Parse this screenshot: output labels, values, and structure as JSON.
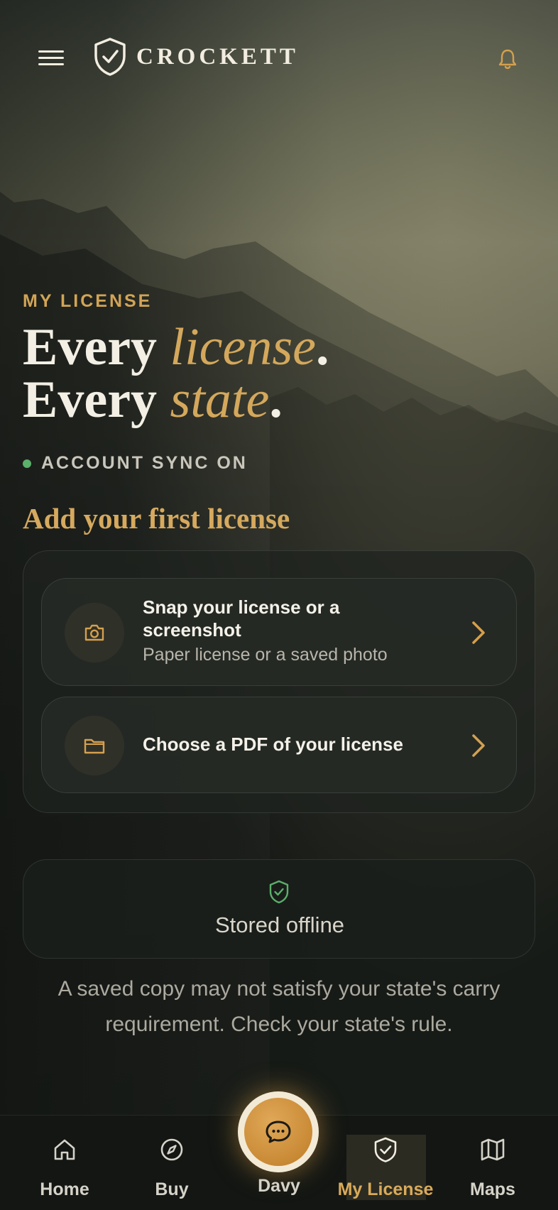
{
  "header": {
    "brand": "CROCKETT",
    "menu_icon": "hamburger-menu-icon",
    "logo_icon": "shield-check-icon",
    "bell_icon": "bell-icon"
  },
  "hero": {
    "eyebrow": "MY LICENSE",
    "line1_plain": "Every ",
    "line1_accent": "license",
    "line1_end": ".",
    "line2_plain": "Every ",
    "line2_accent": "state",
    "line2_end": ".",
    "sync_status": "ACCOUNT SYNC ON"
  },
  "add_section": {
    "title": "Add your first license",
    "options": [
      {
        "icon": "camera-icon",
        "title": "Snap your license or a screenshot",
        "subtitle": "Paper license or a saved photo"
      },
      {
        "icon": "folder-icon",
        "title": "Choose a PDF of your license"
      }
    ]
  },
  "offline": {
    "icon": "shield-check-icon",
    "label": "Stored offline",
    "note": "A saved copy may not satisfy your state's carry requirement. Check your state's rule."
  },
  "nav": {
    "items": [
      {
        "label": "Home",
        "icon": "home-icon"
      },
      {
        "label": "Buy",
        "icon": "compass-icon"
      },
      {
        "label": "Davy",
        "icon": "chat-bubble-icon"
      },
      {
        "label": "My License",
        "icon": "shield-check-icon",
        "active": true
      },
      {
        "label": "Maps",
        "icon": "map-icon"
      }
    ]
  },
  "colors": {
    "accent_gold": "#d4a85c",
    "sync_green": "#5bb06a",
    "background": "#0e110f"
  }
}
